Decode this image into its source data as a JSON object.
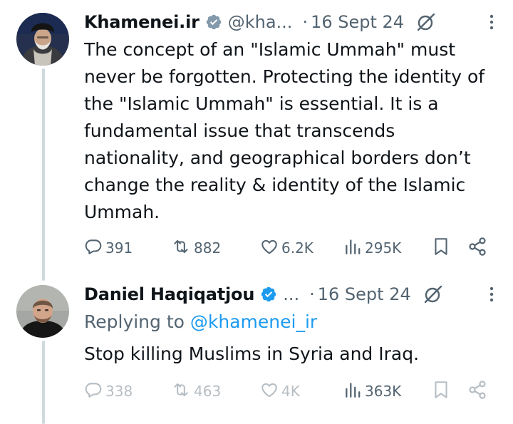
{
  "tweets": [
    {
      "author": {
        "name": "Khamenei.ir",
        "handle": "@kha...",
        "verified_color": "#829aab"
      },
      "separator": "·",
      "date": "16 Sept 24",
      "text": "The concept of an \"Islamic Ummah\" must never be forgotten. Protecting the identity of the \"Islamic Ummah\" is essential. It is a fundamental issue that transcends nationality, and geographical borders don’t change the reality & identity of the Islamic Ummah.",
      "stats": {
        "replies": "391",
        "reposts": "882",
        "likes": "6.2K",
        "views": "295K"
      }
    },
    {
      "author": {
        "name": "Daniel Haqiqatjou",
        "handle": "...",
        "verified_color": "#1d9bf0"
      },
      "separator": "·",
      "date": "16 Sept 24",
      "replying_prefix": "Replying to",
      "replying_handle": "@khamenei_ir",
      "text": "Stop killing Muslims in Syria and Iraq.",
      "stats": {
        "replies": "338",
        "reposts": "463",
        "likes": "4K",
        "views": "363K"
      }
    }
  ],
  "icons": {
    "verified": "verified-badge-icon",
    "grok": "grok-icon",
    "more": "more-options-icon",
    "reply": "reply-icon",
    "repost": "repost-icon",
    "like": "like-icon",
    "views": "views-icon",
    "bookmark": "bookmark-icon",
    "share": "share-icon"
  },
  "colors": {
    "text": "#0f1419",
    "secondary": "#536471",
    "link": "#1d9bf0",
    "thread_line": "#cfd9de"
  }
}
